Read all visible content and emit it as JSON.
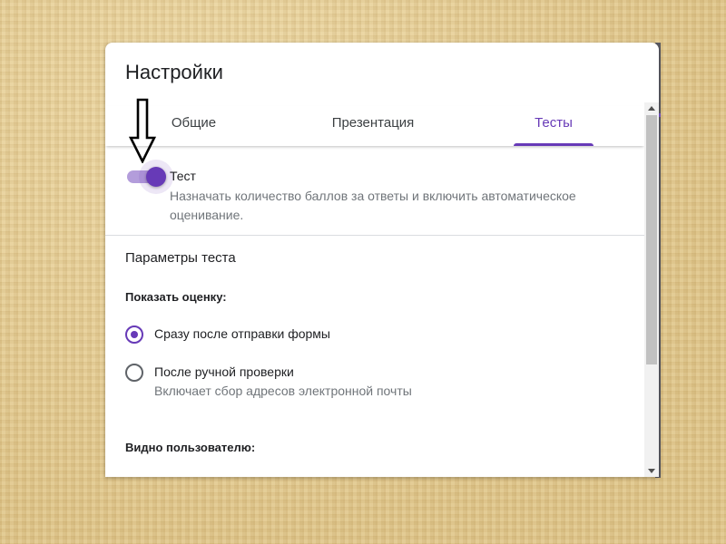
{
  "dialog": {
    "title": "Настройки"
  },
  "tabs": [
    {
      "label": "Общие",
      "active": false
    },
    {
      "label": "Презентация",
      "active": false
    },
    {
      "label": "Тесты",
      "active": true
    }
  ],
  "quiz_toggle": {
    "label": "Тест",
    "description": "Назначать количество баллов за ответы и включить автоматическое оценивание.",
    "enabled": true
  },
  "quiz_options": {
    "section_title": "Параметры теста",
    "release_grade": {
      "heading": "Показать оценку:",
      "options": [
        {
          "label": "Сразу после отправки формы",
          "description": "",
          "selected": true
        },
        {
          "label": "После ручной проверки",
          "description": "Включает сбор адресов электронной почты",
          "selected": false
        }
      ]
    },
    "respondent_can_see_heading": "Видно пользователю:"
  },
  "colors": {
    "accent": "#673ab7",
    "track": "#b39ddb",
    "text": "#202124",
    "secondary_text": "#70757a"
  },
  "icons": {
    "annotation": "down-arrow-outline"
  }
}
